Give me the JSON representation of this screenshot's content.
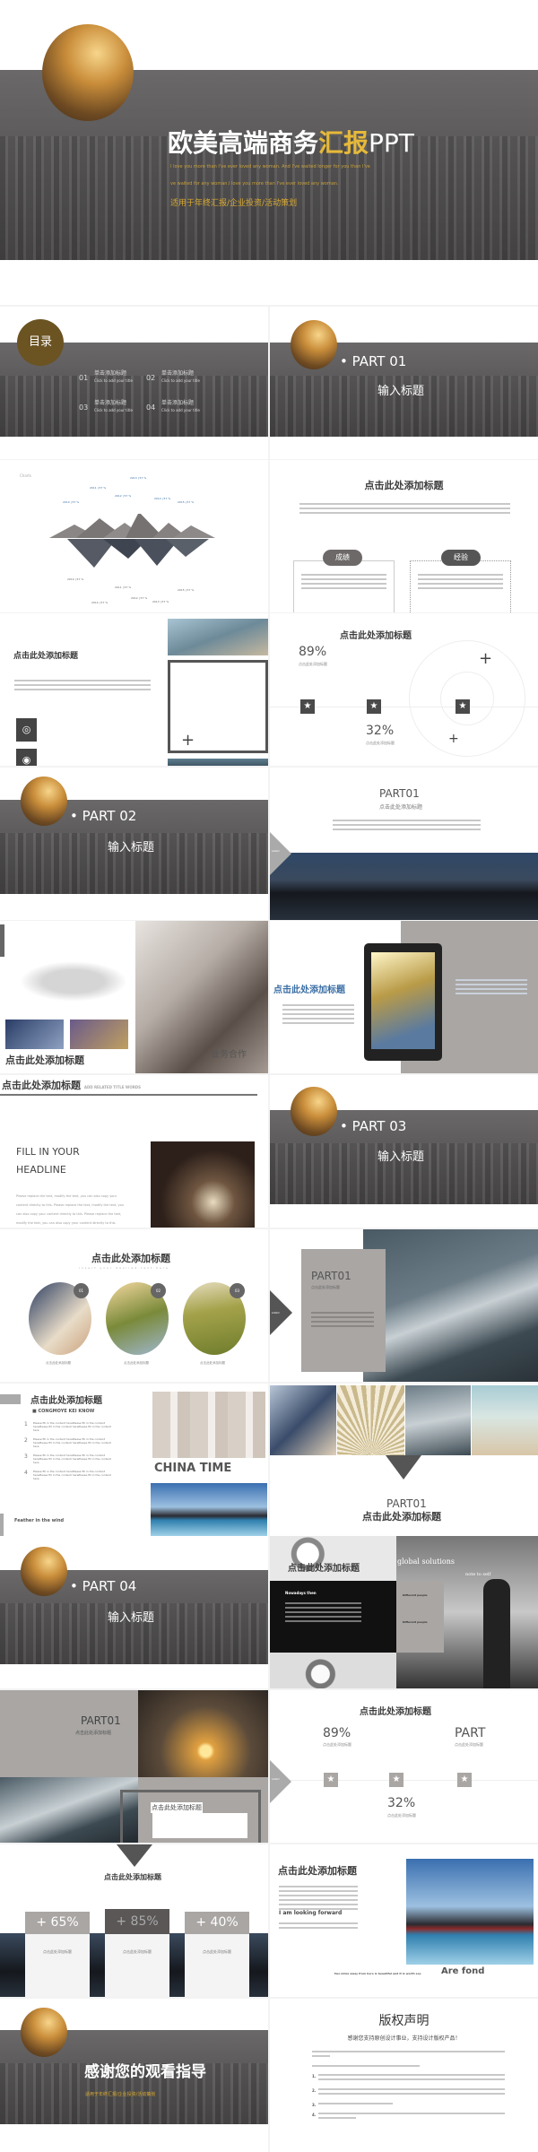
{
  "cover": {
    "title_white": "欧美高端商务",
    "title_gold": "汇报",
    "title_ppt": "PPT",
    "line1": "I love you more than I've ever loved any woman. And I've waited longer for you than I've",
    "line2": "ve waited for any woman.I love you more than I've ever loved any woman.",
    "subtitle": "适用于年终汇报/企业投资/活动策划"
  },
  "colors": {
    "gold": "#d9a932",
    "toc_circle": "#6b5322",
    "gray_panel": "#a9a6a4",
    "dark": "#4a4848",
    "blue_title": "#3a6ea5"
  },
  "toc": {
    "title": "目录",
    "items": [
      {
        "num": "01",
        "cn": "单击添加标题",
        "en": "Click to add your title"
      },
      {
        "num": "02",
        "cn": "单击添加标题",
        "en": "Click to add your title"
      },
      {
        "num": "03",
        "cn": "单击添加标题",
        "en": "Click to add your title"
      },
      {
        "num": "04",
        "cn": "单击添加标题",
        "en": "Click to add your title"
      }
    ]
  },
  "parts": [
    {
      "label": "PART 01",
      "title": "输入标题"
    },
    {
      "label": "PART 02",
      "title": "输入标题"
    },
    {
      "label": "PART 03",
      "title": "输入标题"
    },
    {
      "label": "PART 04",
      "title": "输入标题"
    }
  ],
  "chart_slide": {
    "tag": "Charts",
    "top_labels": [
      "2010 | 57 %",
      "2011 | 57 %",
      "2012 | 57 %",
      "2013 | 57 %",
      "2014 | 57 %",
      "2015 | 57 %"
    ],
    "bottom_labels": [
      "2010 | 57 %",
      "2014 | 57 %",
      "2011 | 57 %",
      "2012 | 57 %",
      "2013 | 57 %",
      "2015 | 57 %"
    ]
  },
  "heading": "点击此处添加标题",
  "results": {
    "left": "成绩",
    "right": "经验"
  },
  "stats": {
    "a": "89%",
    "b": "32%",
    "sub": "点击此处添加标题",
    "part": "PART"
  },
  "part01": {
    "label": "PART01",
    "sub": "点击此处添加标题",
    "logo": "LOGO"
  },
  "biz": {
    "caption": "业务合作",
    "title_en": "ADD RELATED TITLE WORDS"
  },
  "headline": {
    "title1": "FILL IN YOUR",
    "title2": "HEADLINE",
    "body": "Please replace the text, modify the text, you can also copy your content directly to this. Please replace the text, modify the text, you can also copy your content directly to this. Please replace the text, modify the text, you can also copy your content directly to this.",
    "footer": "ADD RELATED TITLE WORDS"
  },
  "circles": {
    "subtitle": "insert your desired text here",
    "nums": [
      "01",
      "02",
      "03"
    ],
    "caption": "点击此处添加标题"
  },
  "china": {
    "sub": "CONGMOYE KEI KNOW",
    "nums": [
      "1",
      "2",
      "3",
      "4"
    ],
    "item": "Please fill in the content herePlease fill in the content herePlease fill in the content herePlease fill in the content here",
    "banner": "CHINA TIME",
    "feather": "Feather in the wind"
  },
  "gears": {
    "global": "global solutions",
    "note": "note to self",
    "nowadays": "Nowadays then",
    "diff1": "Different people",
    "diff2": "Different people"
  },
  "percents": [
    {
      "v": "65%"
    },
    {
      "v": "85%"
    },
    {
      "v": "40%"
    }
  ],
  "ship": {
    "looking": "I am looking forward",
    "footer_small": "two miles away from here is beautiful and it is worth see",
    "footer_big": "Are fond"
  },
  "thanks": {
    "title": "感谢您的观看指导",
    "subtitle": "适用于年终汇报/企业投资/活动策划"
  },
  "copyright": {
    "title": "版权声明",
    "subtitle": "感谢您支持原创设计事业，支持设计版权产品！",
    "items": [
      "1.",
      "2.",
      "3.",
      "4."
    ]
  }
}
